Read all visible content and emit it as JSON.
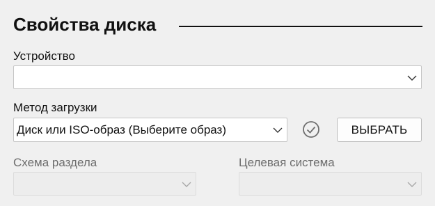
{
  "section": {
    "title": "Свойства диска"
  },
  "device": {
    "label": "Устройство",
    "value": ""
  },
  "boot_method": {
    "label": "Метод загрузки",
    "value": "Диск или ISO-образ (Выберите образ)",
    "select_button": "ВЫБРАТЬ"
  },
  "partition_scheme": {
    "label": "Схема раздела",
    "value": ""
  },
  "target_system": {
    "label": "Целевая система",
    "value": ""
  },
  "icons": {
    "verify": "check-circle-icon",
    "dropdown": "chevron-down-icon"
  }
}
